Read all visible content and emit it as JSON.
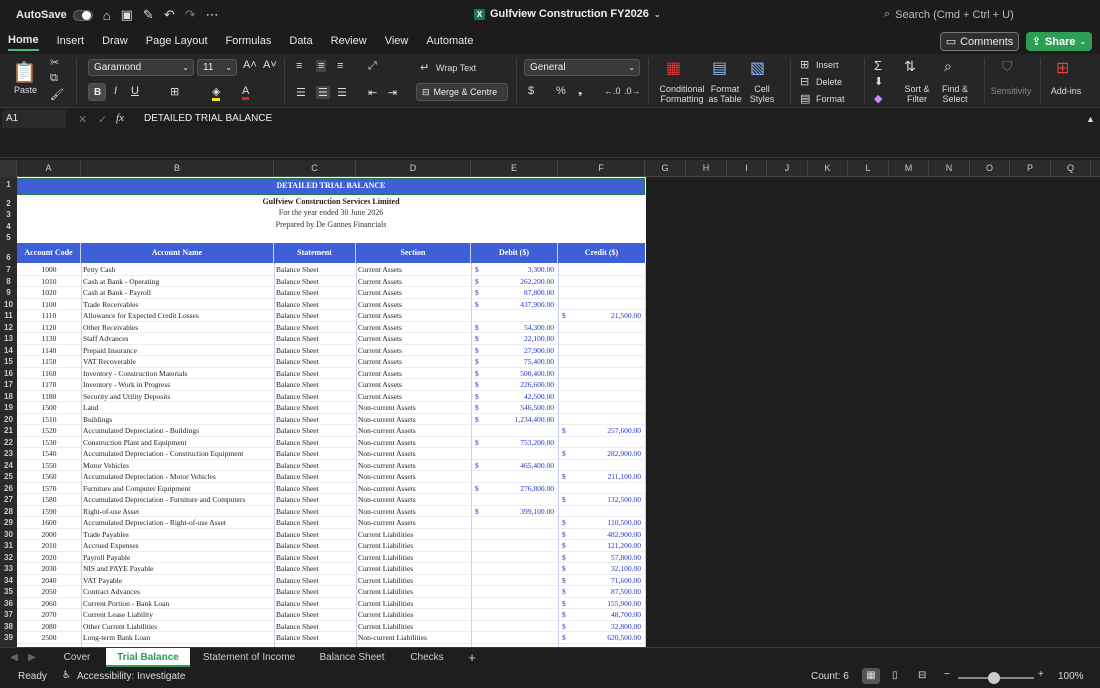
{
  "titlebar": {
    "autosave_label": "AutoSave",
    "document_title": "Gulfview Construction FY2026",
    "search_placeholder": "Search (Cmd + Ctrl + U)"
  },
  "menu": {
    "tabs": [
      "Home",
      "Insert",
      "Draw",
      "Page Layout",
      "Formulas",
      "Data",
      "Review",
      "View",
      "Automate"
    ],
    "active": "Home",
    "comments_label": "Comments",
    "share_label": "Share"
  },
  "ribbon": {
    "paste_label": "Paste",
    "font_name": "Garamond",
    "font_size": "11",
    "wrap_text_label": "Wrap Text",
    "merge_center_label": "Merge & Centre",
    "number_format": "General",
    "conditional_formatting_label": "Conditional Formatting",
    "format_as_table_label": "Format as Table",
    "cell_styles_label": "Cell Styles",
    "insert_label": "Insert",
    "delete_label": "Delete",
    "format_label": "Format",
    "sort_filter_label": "Sort & Filter",
    "find_select_label": "Find & Select",
    "sensitivity_label": "Sensitivity",
    "addins_label": "Add-ins"
  },
  "formula_bar": {
    "name_box": "A1",
    "fx_label": "fx",
    "content": "DETAILED TRIAL BALANCE"
  },
  "columns": [
    "A",
    "B",
    "C",
    "D",
    "E",
    "F",
    "G",
    "H",
    "I",
    "J",
    "K",
    "L",
    "M",
    "N",
    "O",
    "P",
    "Q"
  ],
  "sheet": {
    "title": "DETAILED TRIAL BALANCE",
    "company": "Gulfview Construction Services Limited",
    "period": "For the year ended 30 June 2026",
    "prepared_by": "Prepared by De Gannes Financials",
    "headers": [
      "Account Code",
      "Account Name",
      "Statement",
      "Section",
      "Debit ($)",
      "Credit ($)"
    ],
    "rows": [
      {
        "row": "7",
        "code": "1000",
        "name": "Petty Cash",
        "statement": "Balance Sheet",
        "section": "Current Assets",
        "debit": "3,300.00",
        "credit": ""
      },
      {
        "row": "8",
        "code": "1010",
        "name": "Cash at Bank - Operating",
        "statement": "Balance Sheet",
        "section": "Current Assets",
        "debit": "262,200.00",
        "credit": ""
      },
      {
        "row": "9",
        "code": "1020",
        "name": "Cash at Bank - Payroll",
        "statement": "Balance Sheet",
        "section": "Current Assets",
        "debit": "87,800.00",
        "credit": ""
      },
      {
        "row": "10",
        "code": "1100",
        "name": "Trade Receivables",
        "statement": "Balance Sheet",
        "section": "Current Assets",
        "debit": "437,900.00",
        "credit": ""
      },
      {
        "row": "11",
        "code": "1110",
        "name": "Allowance for Expected Credit Losses",
        "statement": "Balance Sheet",
        "section": "Current Assets",
        "debit": "",
        "credit": "21,500.00"
      },
      {
        "row": "12",
        "code": "1120",
        "name": "Other Receivables",
        "statement": "Balance Sheet",
        "section": "Current Assets",
        "debit": "54,300.00",
        "credit": ""
      },
      {
        "row": "13",
        "code": "1130",
        "name": "Staff Advances",
        "statement": "Balance Sheet",
        "section": "Current Assets",
        "debit": "22,100.00",
        "credit": ""
      },
      {
        "row": "14",
        "code": "1140",
        "name": "Prepaid Insurance",
        "statement": "Balance Sheet",
        "section": "Current Assets",
        "debit": "27,900.00",
        "credit": ""
      },
      {
        "row": "15",
        "code": "1150",
        "name": "VAT Recoverable",
        "statement": "Balance Sheet",
        "section": "Current Assets",
        "debit": "75,400.00",
        "credit": ""
      },
      {
        "row": "16",
        "code": "1160",
        "name": "Inventory - Construction Materials",
        "statement": "Balance Sheet",
        "section": "Current Assets",
        "debit": "500,400.00",
        "credit": ""
      },
      {
        "row": "17",
        "code": "1170",
        "name": "Inventory - Work in Progress",
        "statement": "Balance Sheet",
        "section": "Current Assets",
        "debit": "226,600.00",
        "credit": ""
      },
      {
        "row": "18",
        "code": "1180",
        "name": "Security and Utility Deposits",
        "statement": "Balance Sheet",
        "section": "Current Assets",
        "debit": "42,500.00",
        "credit": ""
      },
      {
        "row": "19",
        "code": "1500",
        "name": "Land",
        "statement": "Balance Sheet",
        "section": "Non-current Assets",
        "debit": "546,500.00",
        "credit": ""
      },
      {
        "row": "20",
        "code": "1510",
        "name": "Buildings",
        "statement": "Balance Sheet",
        "section": "Non-current Assets",
        "debit": "1,234,400.00",
        "credit": ""
      },
      {
        "row": "21",
        "code": "1520",
        "name": "Accumulated Depreciation - Buildings",
        "statement": "Balance Sheet",
        "section": "Non-current Assets",
        "debit": "",
        "credit": "257,600.00"
      },
      {
        "row": "22",
        "code": "1530",
        "name": "Construction Plant and Equipment",
        "statement": "Balance Sheet",
        "section": "Non-current Assets",
        "debit": "753,200.00",
        "credit": ""
      },
      {
        "row": "23",
        "code": "1540",
        "name": "Accumulated Depreciation - Construction Equipment",
        "statement": "Balance Sheet",
        "section": "Non-current Assets",
        "debit": "",
        "credit": "282,900.00"
      },
      {
        "row": "24",
        "code": "1550",
        "name": "Motor Vehicles",
        "statement": "Balance Sheet",
        "section": "Non-current Assets",
        "debit": "465,400.00",
        "credit": ""
      },
      {
        "row": "25",
        "code": "1560",
        "name": "Accumulated Depreciation - Motor Vehicles",
        "statement": "Balance Sheet",
        "section": "Non-current Assets",
        "debit": "",
        "credit": "211,100.00"
      },
      {
        "row": "26",
        "code": "1570",
        "name": "Furniture and Computer Equipment",
        "statement": "Balance Sheet",
        "section": "Non-current Assets",
        "debit": "276,800.00",
        "credit": ""
      },
      {
        "row": "27",
        "code": "1580",
        "name": "Accumulated Depreciation - Furniture and Computers",
        "statement": "Balance Sheet",
        "section": "Non-current Assets",
        "debit": "",
        "credit": "132,500.00"
      },
      {
        "row": "28",
        "code": "1590",
        "name": "Right-of-use Asset",
        "statement": "Balance Sheet",
        "section": "Non-current Assets",
        "debit": "399,100.00",
        "credit": ""
      },
      {
        "row": "29",
        "code": "1600",
        "name": "Accumulated Depreciation - Right-of-use Asset",
        "statement": "Balance Sheet",
        "section": "Non-current Assets",
        "debit": "",
        "credit": "110,500.00"
      },
      {
        "row": "30",
        "code": "2000",
        "name": "Trade Payables",
        "statement": "Balance Sheet",
        "section": "Current Liabilities",
        "debit": "",
        "credit": "482,900.00"
      },
      {
        "row": "31",
        "code": "2010",
        "name": "Accrued Expenses",
        "statement": "Balance Sheet",
        "section": "Current Liabilities",
        "debit": "",
        "credit": "121,200.00"
      },
      {
        "row": "32",
        "code": "2020",
        "name": "Payroll Payable",
        "statement": "Balance Sheet",
        "section": "Current Liabilities",
        "debit": "",
        "credit": "57,800.00"
      },
      {
        "row": "33",
        "code": "2030",
        "name": "NIS and PAYE Payable",
        "statement": "Balance Sheet",
        "section": "Current Liabilities",
        "debit": "",
        "credit": "32,100.00"
      },
      {
        "row": "34",
        "code": "2040",
        "name": "VAT Payable",
        "statement": "Balance Sheet",
        "section": "Current Liabilities",
        "debit": "",
        "credit": "71,600.00"
      },
      {
        "row": "35",
        "code": "2050",
        "name": "Contract Advances",
        "statement": "Balance Sheet",
        "section": "Current Liabilities",
        "debit": "",
        "credit": "87,500.00"
      },
      {
        "row": "36",
        "code": "2060",
        "name": "Current Portion - Bank Loan",
        "statement": "Balance Sheet",
        "section": "Current Liabilities",
        "debit": "",
        "credit": "155,900.00"
      },
      {
        "row": "37",
        "code": "2070",
        "name": "Current Lease Liability",
        "statement": "Balance Sheet",
        "section": "Current Liabilities",
        "debit": "",
        "credit": "48,700.00"
      },
      {
        "row": "38",
        "code": "2080",
        "name": "Other Current Liabilities",
        "statement": "Balance Sheet",
        "section": "Current Liabilities",
        "debit": "",
        "credit": "32,800.00"
      },
      {
        "row": "39",
        "code": "2500",
        "name": "Long-term Bank Loan",
        "statement": "Balance Sheet",
        "section": "Non-current Liabilities",
        "debit": "",
        "credit": "620,500.00"
      }
    ],
    "header_rows": [
      "1",
      "2",
      "3",
      "4",
      "5",
      "6"
    ],
    "currency_symbol": "$"
  },
  "sheet_tabs": {
    "tabs": [
      "Cover",
      "Trial Balance",
      "Statement of Income",
      "Balance Sheet",
      "Checks"
    ],
    "active": "Trial Balance",
    "add_label": "+"
  },
  "status": {
    "ready": "Ready",
    "accessibility": "Accessibility: Investigate",
    "count": "Count: 6",
    "zoom": "100%"
  },
  "colors": {
    "header_blue": "#3f5fd9",
    "accent_green": "#2f9e55",
    "value_blue": "#2233cc"
  }
}
